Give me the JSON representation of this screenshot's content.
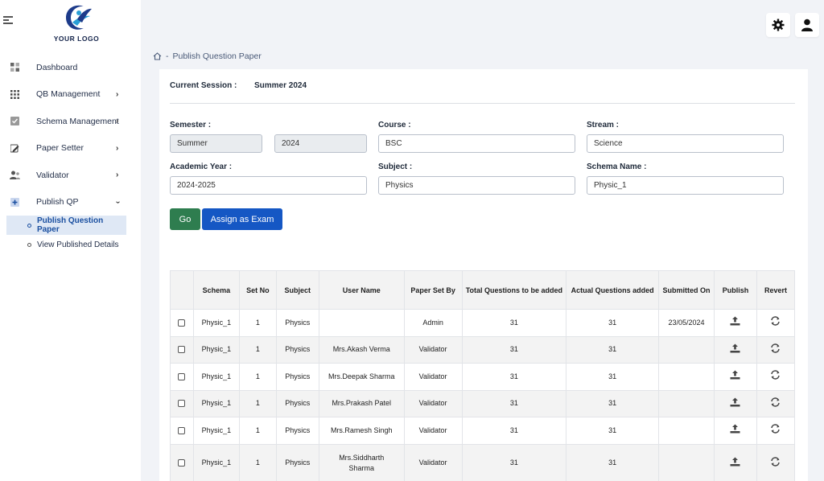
{
  "logo": {
    "text": "YOUR LOGO"
  },
  "sidebar": {
    "items": [
      {
        "label": "Dashboard",
        "icon": "grid-icon"
      },
      {
        "label": "QB Management",
        "icon": "dots-grid-icon"
      },
      {
        "label": "Schema Management",
        "icon": "checkbox-icon"
      },
      {
        "label": "Paper Setter",
        "icon": "pencil-icon"
      },
      {
        "label": "Validator",
        "icon": "users-icon"
      },
      {
        "label": "Publish QP",
        "icon": "publish-icon"
      }
    ],
    "subitems": [
      {
        "label": "Publish Question Paper"
      },
      {
        "label": "View Published Details"
      }
    ]
  },
  "breadcrumb": {
    "current": "Publish Question Paper"
  },
  "session": {
    "label": "Current Session :",
    "value": "Summer 2024"
  },
  "form": {
    "semester_label": "Semester :",
    "semester_value": "Summer",
    "year_value": "2024",
    "course_label": "Course :",
    "course_value": "BSC",
    "stream_label": "Stream :",
    "stream_value": "Science",
    "academic_year_label": "Academic Year :",
    "academic_year_value": "2024-2025",
    "subject_label": "Subject :",
    "subject_value": "Physics",
    "schema_label": "Schema Name :",
    "schema_value": "Physic_1"
  },
  "buttons": {
    "go": "Go",
    "assign": "Assign as Exam"
  },
  "table": {
    "headers": [
      "Schema",
      "Set No",
      "Subject",
      "User Name",
      "Paper Set By",
      "Total Questions to be added",
      "Actual Questions added",
      "Submitted On",
      "Publish",
      "Revert"
    ],
    "rows": [
      {
        "schema": "Physic_1",
        "set_no": "1",
        "subject": "Physics",
        "user": "",
        "set_by": "Admin",
        "total": "31",
        "actual": "31",
        "submitted": "23/05/2024"
      },
      {
        "schema": "Physic_1",
        "set_no": "1",
        "subject": "Physics",
        "user": "Mrs.Akash Verma",
        "set_by": "Validator",
        "total": "31",
        "actual": "31",
        "submitted": ""
      },
      {
        "schema": "Physic_1",
        "set_no": "1",
        "subject": "Physics",
        "user": "Mrs.Deepak Sharma",
        "set_by": "Validator",
        "total": "31",
        "actual": "31",
        "submitted": ""
      },
      {
        "schema": "Physic_1",
        "set_no": "1",
        "subject": "Physics",
        "user": "Mrs.Prakash Patel",
        "set_by": "Validator",
        "total": "31",
        "actual": "31",
        "submitted": ""
      },
      {
        "schema": "Physic_1",
        "set_no": "1",
        "subject": "Physics",
        "user": "Mrs.Ramesh Singh",
        "set_by": "Validator",
        "total": "31",
        "actual": "31",
        "submitted": ""
      },
      {
        "schema": "Physic_1",
        "set_no": "1",
        "subject": "Physics",
        "user": "Mrs.Siddharth Sharma",
        "set_by": "Validator",
        "total": "31",
        "actual": "31",
        "submitted": ""
      }
    ]
  },
  "colors": {
    "go": "#2e7d4f",
    "assign": "#1557c4",
    "active_bg": "#dfe8f5",
    "active_text": "#1a4fa0"
  }
}
